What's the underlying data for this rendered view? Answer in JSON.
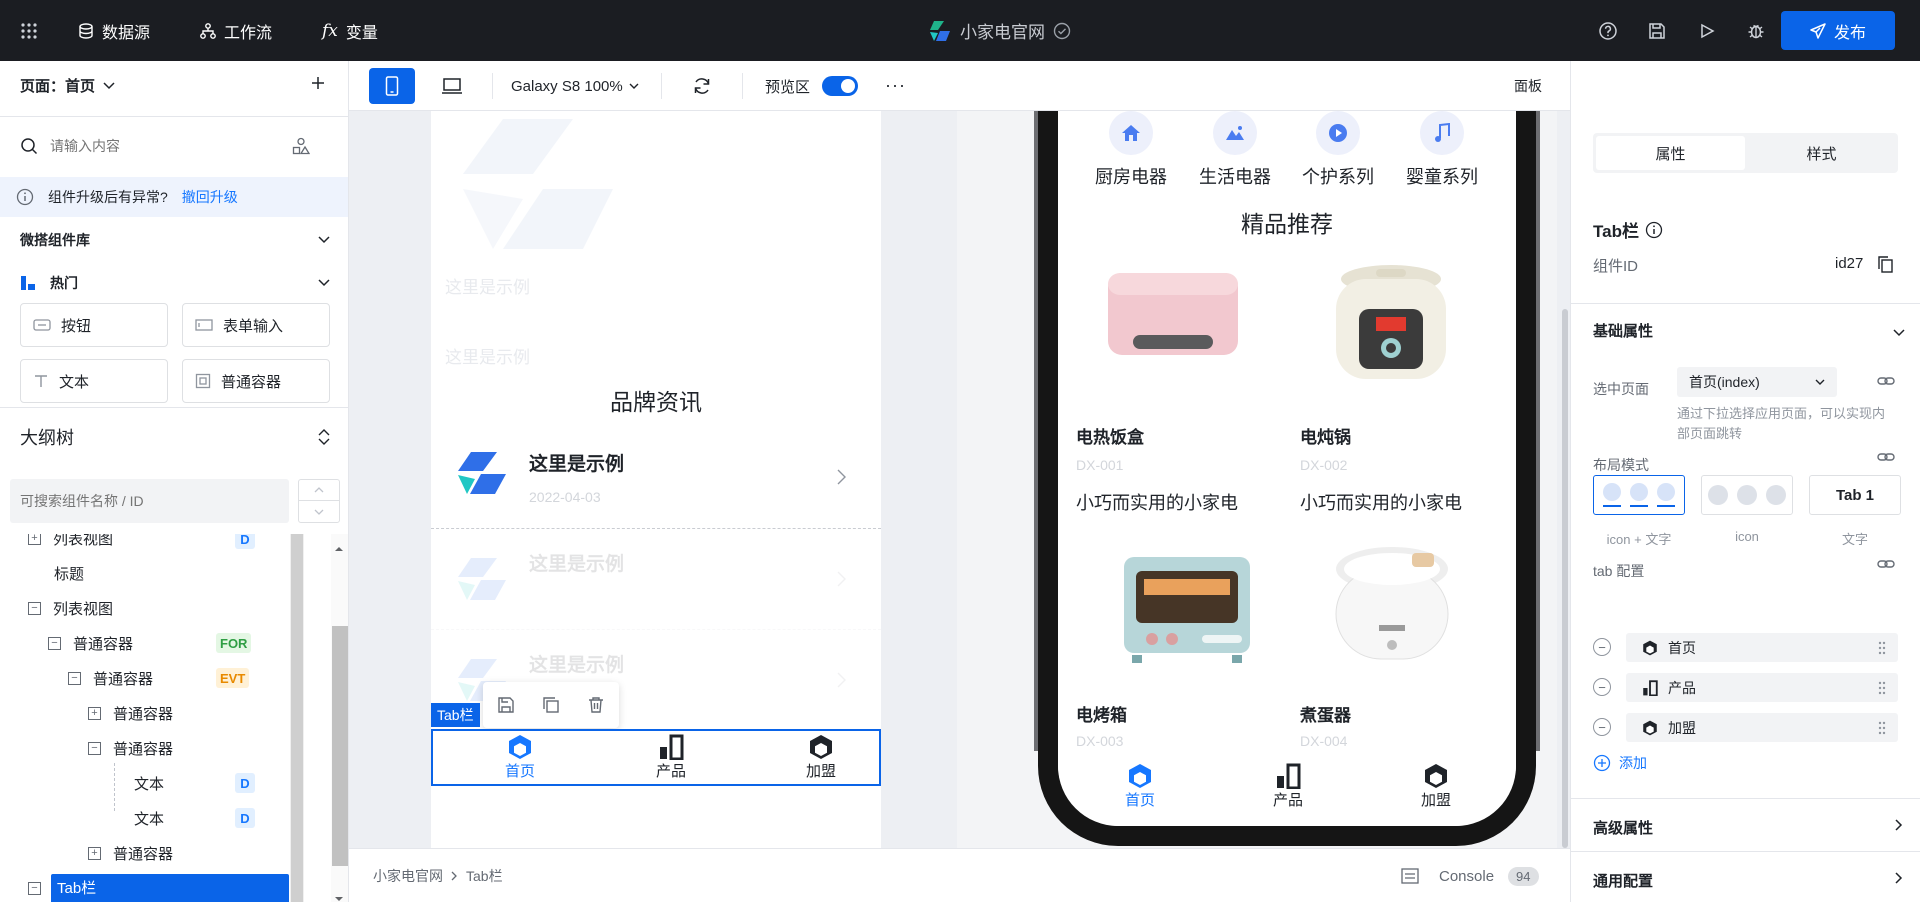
{
  "topbar": {
    "datasource": "数据源",
    "workflow": "工作流",
    "variables": "变量",
    "app_name": "小家电官网",
    "publish": "发布"
  },
  "left": {
    "page_label": "页面：首页",
    "search_placeholder": "请输入内容",
    "notice_text": "组件升级后有异常?",
    "notice_link": "撤回升级",
    "library_title": "微搭组件库",
    "hot_title": "热门",
    "components": [
      "按钮",
      "表单输入",
      "文本",
      "普通容器"
    ],
    "outline_title": "大纲树",
    "outline_search_placeholder": "可搜索组件名称 / ID",
    "tree": [
      {
        "label": "列表视图",
        "badge": "D"
      },
      {
        "label": "标题",
        "badge": ""
      },
      {
        "label": "列表视图",
        "badge": ""
      },
      {
        "label": "普通容器",
        "badge": "FOR"
      },
      {
        "label": "普通容器",
        "badge": "EVT"
      },
      {
        "label": "普通容器",
        "badge": ""
      },
      {
        "label": "普通容器",
        "badge": ""
      },
      {
        "label": "文本",
        "badge": "D"
      },
      {
        "label": "文本",
        "badge": "D"
      },
      {
        "label": "普通容器",
        "badge": ""
      },
      {
        "label": "Tab栏",
        "badge": ""
      }
    ]
  },
  "toolbar": {
    "device": "Galaxy S8 100%",
    "preview_label": "预览区",
    "panel": "面板"
  },
  "editor": {
    "ghost_texts": [
      "这里是示例",
      "这里是示例"
    ],
    "section_title": "品牌资讯",
    "news": [
      {
        "title": "这里是示例",
        "date": "2022-04-03"
      },
      {
        "title": "这里是示例",
        "date": ""
      },
      {
        "title": "这里是示例",
        "date": ""
      }
    ],
    "selected_tag": "Tab栏",
    "tabs": [
      "首页",
      "产品",
      "加盟"
    ]
  },
  "phone": {
    "categories": [
      "厨房电器",
      "生活电器",
      "个护系列",
      "婴童系列"
    ],
    "section_title": "精品推荐",
    "products": [
      {
        "name": "电热饭盒",
        "code": "DX-001",
        "desc": "小巧而实用的小家电"
      },
      {
        "name": "电炖锅",
        "code": "DX-002",
        "desc": "小巧而实用的小家电"
      },
      {
        "name": "电烤箱",
        "code": "DX-003",
        "desc": ""
      },
      {
        "name": "煮蛋器",
        "code": "DX-004",
        "desc": ""
      }
    ],
    "tabs": [
      "首页",
      "产品",
      "加盟"
    ]
  },
  "right": {
    "tab_attr": "属性",
    "tab_style": "样式",
    "component_title": "Tab栏",
    "id_label": "组件ID",
    "id_value": "id27",
    "basic_title": "基础属性",
    "page_select_label": "选中页面",
    "page_select_value": "首页(index)",
    "page_hint": "通过下拉选择应用页面，可以实现内部页面跳转",
    "layout_label": "布局模式",
    "layout_options": [
      "icon + 文字",
      "icon",
      "文字"
    ],
    "layout_tab_text": "Tab 1",
    "tab_config_label": "tab 配置",
    "tab_config": [
      "首页",
      "产品",
      "加盟"
    ],
    "add": "添加",
    "advanced": "高级属性",
    "general": "通用配置"
  },
  "bottom": {
    "breadcrumb_root": "小家电官网",
    "breadcrumb_current": "Tab栏",
    "console": "Console",
    "console_count": "94"
  },
  "colors": {
    "accent": "#0a64e8",
    "topbar": "#1b1d22",
    "tab_active": "#1677ff"
  }
}
